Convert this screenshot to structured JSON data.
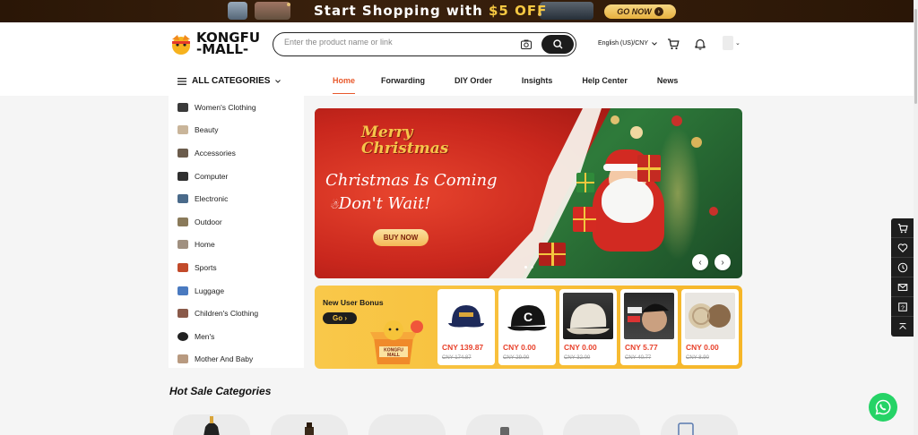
{
  "promo": {
    "text_prefix": "Start Shopping with ",
    "text_highlight": "$5 OFF",
    "cta": "GO NOW"
  },
  "header": {
    "logo_line1": "KONGFU",
    "logo_line2": "-MALL-",
    "search_placeholder": "Enter the product name or link",
    "language": "English (US)/CNY"
  },
  "nav": {
    "all_categories": "ALL CATEGORIES",
    "items": [
      "Home",
      "Forwarding",
      "DIY Order",
      "Insights",
      "Help Center",
      "News"
    ],
    "active": "Home"
  },
  "categories": [
    "Women's Clothing",
    "Beauty",
    "Accessories",
    "Computer",
    "Electronic",
    "Outdoor",
    "Home",
    "Sports",
    "Luggage",
    "Children's Clothing",
    "Men's",
    "Mother And Baby"
  ],
  "banner": {
    "merry_line1": "Merry",
    "merry_line2": "Christmas",
    "title_line1": "Christmas Is Coming",
    "title_line2": "Don't Wait!",
    "button": "BUY NOW",
    "prev": "‹",
    "next": "›"
  },
  "bonus": {
    "title": "New User Bonus",
    "go": "Go ›",
    "mascot_line1": "KONGFU",
    "mascot_line2": "MALL",
    "products": [
      {
        "price": "CNY 139.87",
        "old": "CNY 174.87"
      },
      {
        "price": "CNY 0.00",
        "old": "CNY 29.00"
      },
      {
        "price": "CNY 0.00",
        "old": "CNY 32.00"
      },
      {
        "price": "CNY 5.77",
        "old": "CNY 40.77"
      },
      {
        "price": "CNY 0.00",
        "old": "CNY 8.90"
      }
    ]
  },
  "hot_sale": {
    "title": "Hot Sale Categories"
  },
  "colors": {
    "accent": "#e8592c",
    "promo_bg": "#2a1606",
    "bonus_bg": "#f6b628",
    "whatsapp": "#25d366"
  },
  "icons": {
    "header": [
      "cart-icon",
      "bell-icon"
    ],
    "float_bar": [
      "cart-icon",
      "heart-icon",
      "clock-icon",
      "mail-icon",
      "help-icon",
      "back-to-top-icon"
    ]
  }
}
